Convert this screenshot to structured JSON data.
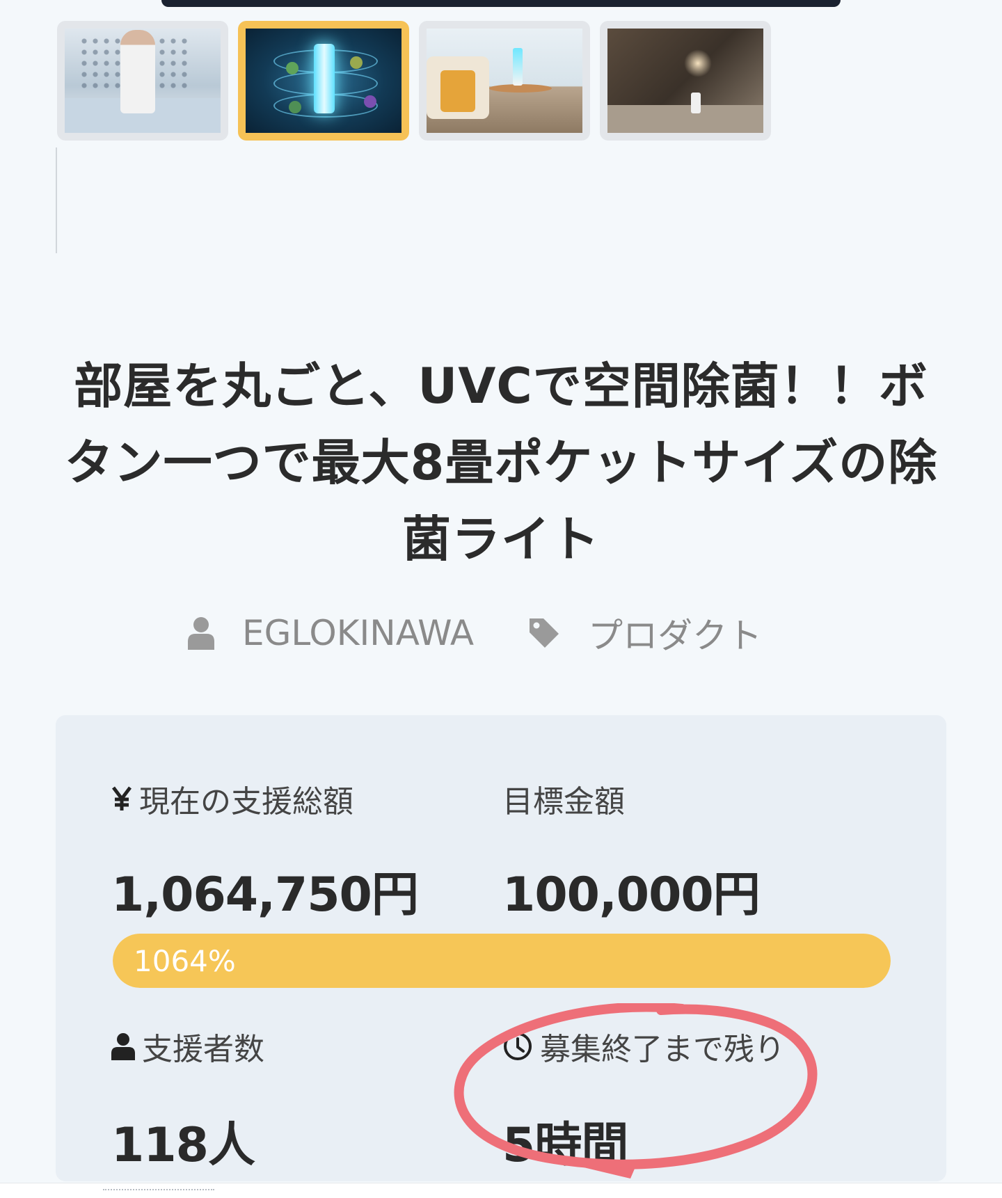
{
  "gallery": {
    "active_index": 1,
    "thumbnails": [
      {
        "label": "kitchen-scene"
      },
      {
        "label": "uvc-light-germs"
      },
      {
        "label": "living-room-scene"
      },
      {
        "label": "bedroom-scene"
      }
    ]
  },
  "project": {
    "title_lines": [
      "部屋を丸ごと、UVCで空間除菌！！ボ",
      "タン一つで最大8畳ポケットサイズの除",
      "菌ライト"
    ],
    "owner": "EGLOKINAWA",
    "category": "プロダクト"
  },
  "stats": {
    "raised_label": "現在の支援総額",
    "raised_value": "1,064,750円",
    "goal_label": "目標金額",
    "goal_value": "100,000円",
    "progress_text": "1064%",
    "progress_fraction": 1.0,
    "backers_label": "支援者数",
    "backers_value": "118人",
    "remaining_label": "募集終了まで残り",
    "remaining_value": "5時間"
  },
  "colors": {
    "accent": "#f6c657",
    "annotation": "#ee6f78",
    "background": "#f4f8fb",
    "card": "#e9eff5"
  },
  "icons": {
    "owner": "user-icon",
    "category": "tag-icon",
    "raised": "yen-icon",
    "backers": "user-icon",
    "remaining": "clock-icon"
  }
}
